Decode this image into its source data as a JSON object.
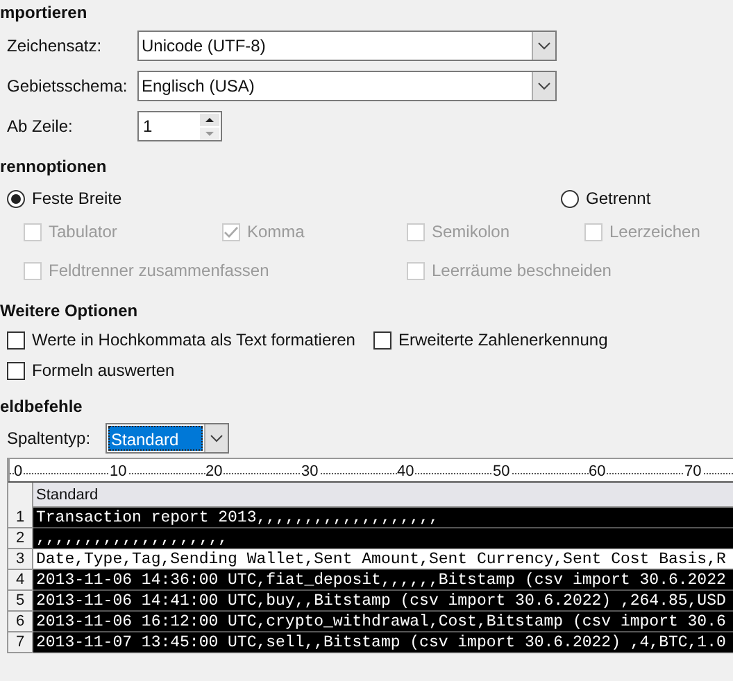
{
  "import": {
    "heading": "mportieren",
    "fields": [
      {
        "kind": "dropdown",
        "label": "Zeichensatz:",
        "value": "Unicode (UTF-8)"
      },
      {
        "kind": "dropdown",
        "label": "Gebietsschema:",
        "value": "Englisch (USA)"
      },
      {
        "kind": "spinner",
        "label": "Ab Zeile:",
        "value": "1"
      }
    ]
  },
  "separator_options": {
    "heading": "rennoptionen",
    "modes": [
      {
        "label": "Feste Breite",
        "selected": true
      },
      {
        "label": "Getrennt",
        "selected": false
      }
    ],
    "checkboxes": [
      {
        "label": "Tabulator",
        "checked": false,
        "disabled": true
      },
      {
        "label": "Komma",
        "checked": true,
        "disabled": true
      },
      {
        "label": "Semikolon",
        "checked": false,
        "disabled": true
      },
      {
        "label": "Leerzeichen",
        "checked": false,
        "disabled": true
      },
      {
        "label": "Feldtrenner zusammenfassen",
        "checked": false,
        "disabled": true
      },
      {
        "label": "Leerräume beschneiden",
        "checked": false,
        "disabled": true
      }
    ]
  },
  "other_options": {
    "heading": "Weitere Optionen",
    "checkboxes": [
      {
        "label": "Werte in Hochkommata als Text formatieren",
        "checked": false
      },
      {
        "label": "Erweiterte Zahlenerkennung",
        "checked": false
      },
      {
        "label": "Formeln auswerten",
        "checked": false
      }
    ]
  },
  "field_commands": {
    "heading": "eldbefehle",
    "column_type_label": "Spaltentyp:",
    "column_type_value": "Standard"
  },
  "preview": {
    "ruler": [
      "0",
      "10",
      "20",
      "30",
      "40",
      "50",
      "60",
      "70"
    ],
    "column_header": "Standard",
    "rows": [
      {
        "number": "1",
        "text": "Transaction report 2013,,,,,,,,,,,,,,,,,,,",
        "selected": true
      },
      {
        "number": "2",
        "text": ",,,,,,,,,,,,,,,,,,,,",
        "selected": true
      },
      {
        "number": "3",
        "text": "Date,Type,Tag,Sending Wallet,Sent Amount,Sent Currency,Sent Cost Basis,R",
        "selected": false
      },
      {
        "number": "4",
        "text": "2013-11-06 14:36:00 UTC,fiat_deposit,,,,,,Bitstamp (csv import 30.6.2022",
        "selected": true
      },
      {
        "number": "5",
        "text": "2013-11-06 14:41:00 UTC,buy,,Bitstamp (csv import 30.6.2022) ,264.85,USD",
        "selected": true
      },
      {
        "number": "6",
        "text": "2013-11-06 16:12:00 UTC,crypto_withdrawal,Cost,Bitstamp (csv import 30.6",
        "selected": true
      },
      {
        "number": "7",
        "text": "2013-11-07 13:45:00 UTC,sell,,Bitstamp (csv import 30.6.2022) ,4,BTC,1.0",
        "selected": true
      }
    ]
  }
}
